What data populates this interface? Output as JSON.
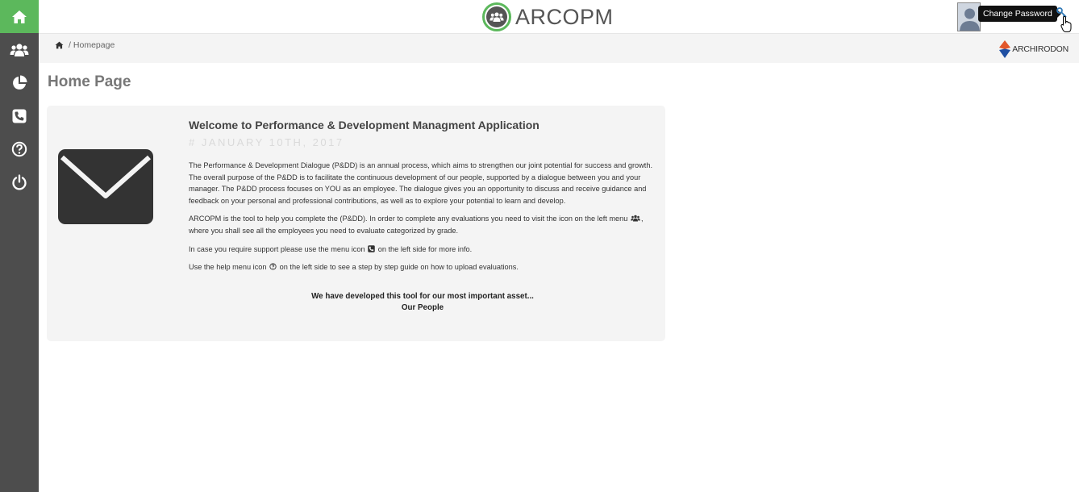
{
  "app": {
    "logo_text": "ARCOPM",
    "brand_text": "ARCHIRODON"
  },
  "header": {
    "tooltip": "Change Password"
  },
  "sidebar": {
    "items": [
      {
        "name": "home",
        "icon": "home-icon",
        "active": true
      },
      {
        "name": "employees",
        "icon": "users-icon"
      },
      {
        "name": "reports",
        "icon": "pie-chart-icon"
      },
      {
        "name": "support",
        "icon": "phone-icon"
      },
      {
        "name": "help",
        "icon": "question-icon"
      },
      {
        "name": "logout",
        "icon": "power-icon"
      }
    ]
  },
  "breadcrumb": {
    "separator": "/",
    "current": "Homepage"
  },
  "page": {
    "title": "Home Page"
  },
  "card": {
    "heading": "Welcome to Performance & Development Managment Application",
    "date": "# JANUARY 10TH, 2017",
    "para1": "The Performance & Development Dialogue (P&DD) is an annual process, which aims to strengthen our joint potential for success and growth. The overall purpose of the P&DD is to facilitate the continuous development of our people, supported by a dialogue between you and your manager. The P&DD process focuses on YOU as an employee. The dialogue gives you an opportunity to discuss and receive guidance and feedback on your personal and professional contributions, as well as to explore your potential to learn and develop.",
    "para2_a": "ARCOPM is the tool to help you complete the (P&DD). In order to complete any evaluations you need to visit the icon on the left menu",
    "para2_b": ", where you shall see all the employees you need to evaluate categorized by grade.",
    "para3_a": "In case you require support please use the menu icon",
    "para3_b": "on the left side for more info.",
    "para4_a": "Use the help menu icon",
    "para4_b": "on the left side to see a step by step guide on how to upload evaluations.",
    "closing_line1": "We have developed this tool for our most important asset...",
    "closing_line2": "Our People"
  },
  "colors": {
    "accent": "#5cb85c",
    "sidebar": "#4d4d4d",
    "card": "#f4f4f4"
  }
}
